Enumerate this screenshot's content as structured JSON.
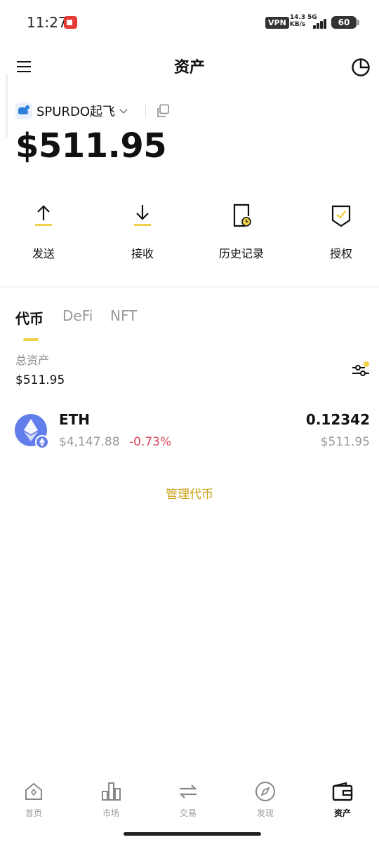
{
  "status_bar": {
    "time": "11:27",
    "vpn": "VPN",
    "net_speed": "14.3 KB/s",
    "net_type": "5G",
    "battery": "60"
  },
  "header": {
    "title": "资产",
    "icons": [
      "menu-icon",
      "pie-chart-icon"
    ]
  },
  "wallet": {
    "name": "SPURDO起飞",
    "balance": "$511.95"
  },
  "actions": [
    {
      "label": "发送",
      "icon": "send-arrow-up-icon"
    },
    {
      "label": "接收",
      "icon": "receive-arrow-down-icon"
    },
    {
      "label": "历史记录",
      "icon": "history-icon"
    },
    {
      "label": "授权",
      "icon": "authorization-shield-icon"
    }
  ],
  "tabs": [
    {
      "label": "代币",
      "active": true
    },
    {
      "label": "DeFi",
      "active": false
    },
    {
      "label": "NFT",
      "active": false
    }
  ],
  "totals": {
    "label": "总资产",
    "value": "$511.95"
  },
  "assets": [
    {
      "symbol": "ETH",
      "price": "$4,147.88",
      "change": "-0.73%",
      "amount": "0.12342",
      "value": "$511.95"
    }
  ],
  "manage_label": "管理代币",
  "bottom_nav": [
    {
      "label": "首页",
      "icon": "home-icon",
      "active": false
    },
    {
      "label": "市场",
      "icon": "market-bars-icon",
      "active": false
    },
    {
      "label": "交易",
      "icon": "swap-icon",
      "active": false
    },
    {
      "label": "发现",
      "icon": "compass-icon",
      "active": false
    },
    {
      "label": "资产",
      "icon": "wallet-icon",
      "active": true
    }
  ],
  "colors": {
    "accent": "#f0d24a",
    "link": "#caa015",
    "negative": "#d9475e",
    "eth": "#627eea"
  }
}
